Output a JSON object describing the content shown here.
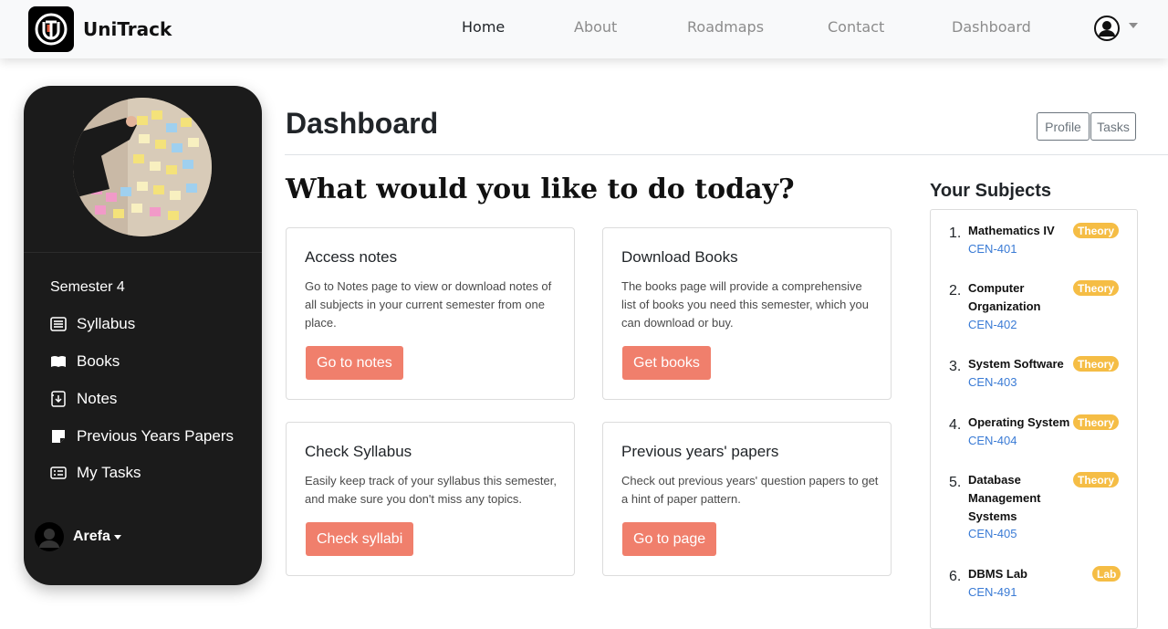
{
  "navbar": {
    "brand": "UniTrack",
    "links": [
      {
        "label": "Home"
      },
      {
        "label": "About"
      },
      {
        "label": "Roadmaps"
      },
      {
        "label": "Contact"
      },
      {
        "label": "Dashboard"
      }
    ],
    "user_icon": "user-circle-icon"
  },
  "sidebar": {
    "semester": "Semester 4",
    "items": [
      {
        "label": "Syllabus",
        "icon": "syllabus-icon"
      },
      {
        "label": "Books",
        "icon": "book-icon"
      },
      {
        "label": "Notes",
        "icon": "notes-icon"
      },
      {
        "label": "Previous Years Papers",
        "icon": "papers-icon"
      },
      {
        "label": "My Tasks",
        "icon": "tasks-icon"
      }
    ],
    "user_name": "Arefa"
  },
  "main": {
    "title": "Dashboard",
    "profile_button": "Profile",
    "tasks_button": "Tasks",
    "headline": "What would you like to do today?",
    "cards": [
      {
        "title": "Access notes",
        "text": "Go to Notes page to view or download notes of all subjects in your current semester from one place.",
        "button": "Go to notes"
      },
      {
        "title": "Download Books",
        "text": "The books page will provide a comprehensive list of books you need this semester, which you can download or buy.",
        "button": "Get books"
      },
      {
        "title": "Check Syllabus",
        "text": "Easily keep track of your syllabus this semester, and make sure you don't miss any topics.",
        "button": "Check syllabi"
      },
      {
        "title": "Previous years' papers",
        "text": "Check out previous years' question papers to get a hint of paper pattern.",
        "button": "Go to page"
      }
    ]
  },
  "subjects": {
    "title": "Your Subjects",
    "items": [
      {
        "num": "1.",
        "name": "Mathematics IV",
        "code": "CEN-401",
        "badge": "Theory"
      },
      {
        "num": "2.",
        "name": "Computer Organization",
        "code": "CEN-402",
        "badge": "Theory"
      },
      {
        "num": "3.",
        "name": "System Software",
        "code": "CEN-403",
        "badge": "Theory"
      },
      {
        "num": "4.",
        "name": "Operating System",
        "code": "CEN-404",
        "badge": "Theory"
      },
      {
        "num": "5.",
        "name": "Database Management Systems",
        "code": "CEN-405",
        "badge": "Theory"
      },
      {
        "num": "6.",
        "name": "DBMS Lab",
        "code": "CEN-491",
        "badge": "Lab"
      }
    ]
  },
  "colors": {
    "accent_button": "#f07f6c",
    "badge": "#f5bd45",
    "link": "#3a7bd5",
    "sidebar_bg": "#1b1b1b"
  }
}
